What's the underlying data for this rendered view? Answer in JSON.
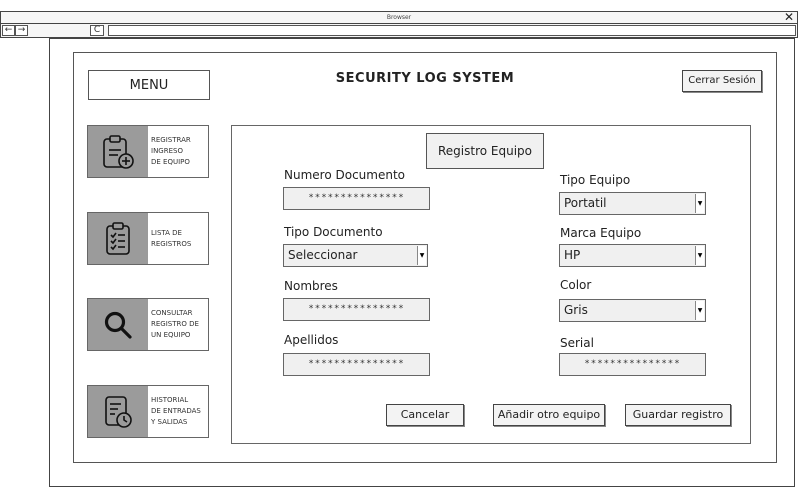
{
  "browser": {
    "title": "Browser",
    "close_glyph": "✕",
    "back_glyph": "←",
    "forward_glyph": "→",
    "reload_glyph": "C"
  },
  "header": {
    "menu_label": "MENU",
    "app_title": "SECURITY LOG SYSTEM",
    "logout_label": "Cerrar Sesión"
  },
  "sidebar": {
    "items": [
      {
        "lines": [
          "REGISTRAR",
          "INGRESO",
          "DE EQUIPO"
        ],
        "icon": "clipboard-add-icon"
      },
      {
        "lines": [
          "LISTA DE",
          "REGISTROS"
        ],
        "icon": "clipboard-list-icon"
      },
      {
        "lines": [
          "CONSULTAR",
          "REGISTRO DE",
          "UN EQUIPO"
        ],
        "icon": "search-icon"
      },
      {
        "lines": [
          "HISTORIAL",
          "DE ENTRADAS",
          "Y SALIDAS"
        ],
        "icon": "history-icon"
      }
    ]
  },
  "form": {
    "header": "Registro Equipo",
    "numero_documento": {
      "label": "Numero Documento",
      "value": "***************"
    },
    "tipo_documento": {
      "label": "Tipo Documento",
      "value": "Seleccionar"
    },
    "nombres": {
      "label": "Nombres",
      "value": "***************"
    },
    "apellidos": {
      "label": "Apellidos",
      "value": "***************"
    },
    "tipo_equipo": {
      "label": "Tipo Equipo",
      "value": "Portatil"
    },
    "marca_equipo": {
      "label": "Marca Equipo",
      "value": "HP"
    },
    "color": {
      "label": "Color",
      "value": "Gris"
    },
    "serial": {
      "label": "Serial",
      "value": "***************"
    },
    "buttons": {
      "cancel": "Cancelar",
      "add_another": "Añadir otro equipo",
      "save": "Guardar registro"
    }
  }
}
